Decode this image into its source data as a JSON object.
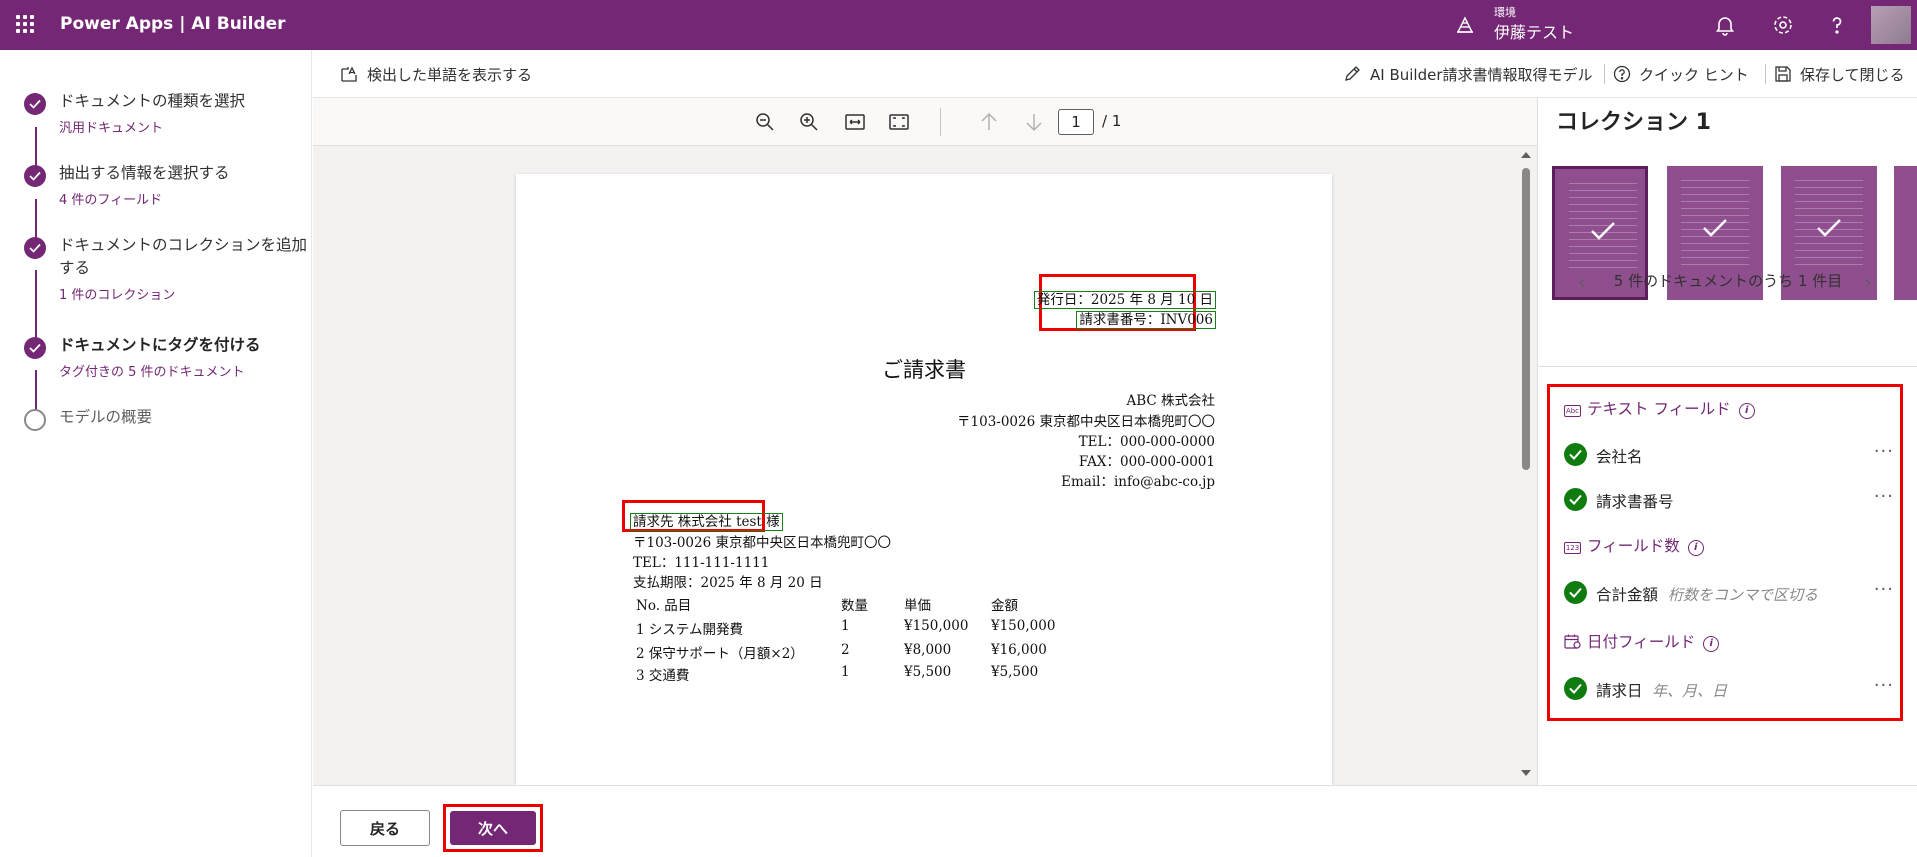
{
  "topbar": {
    "brand": "Power Apps  |  AI Builder",
    "env_label": "環境",
    "env_name": "伊藤テスト"
  },
  "steps": [
    {
      "title": "ドキュメントの種類を選択",
      "sub": "汎用ドキュメント",
      "state": "done"
    },
    {
      "title": "抽出する情報を選択する",
      "sub": "4 件のフィールド",
      "state": "done"
    },
    {
      "title": "ドキュメントのコレクションを追加する",
      "sub": "1 件のコレクション",
      "state": "done"
    },
    {
      "title": "ドキュメントにタグを付ける",
      "sub": "タグ付きの 5 件のドキュメント",
      "state": "current"
    },
    {
      "title": "モデルの概要",
      "sub": "",
      "state": "pending"
    }
  ],
  "toolbar": {
    "show_words": "検出した単語を表示する",
    "model_name": "AI Builder請求書情報取得モデル",
    "quick_hint": "クイック ヒント",
    "save_close": "保存して閉じる"
  },
  "viewer": {
    "page_current": "1",
    "page_total": "/ 1"
  },
  "doc": {
    "issue_date": "発行日：2025 年 8 月 10 日",
    "invoice_no": "請求書番号：INV006",
    "title": "ご請求書",
    "company": "ABC 株式会社",
    "address": "〒103-0026  東京都中央区日本橋兜町〇〇",
    "tel": "TEL：000-000-0000",
    "fax": "FAX：000-000-0001",
    "email": "Email：info@abc-co.jp",
    "bill_to": "請求先  株式会社 test  様",
    "client_address": "〒103-0026  東京都中央区日本橋兜町〇〇",
    "client_tel": "TEL：111-111-1111",
    "due_date": "支払期限：2025 年 8 月 20 日",
    "table": {
      "headers": [
        "No. 品目",
        "数量",
        "単価",
        "金額"
      ],
      "rows": [
        [
          "1     システム開発費",
          "1",
          "¥150,000",
          "¥150,000"
        ],
        [
          "2     保守サポート（月額×2）",
          "2",
          "¥8,000",
          "¥16,000"
        ],
        [
          "3     交通費",
          "1",
          "¥5,500",
          "¥5,500"
        ]
      ]
    }
  },
  "collection": {
    "title": "コレクション 1",
    "pager": "5 件のドキュメントのうち 1 件目"
  },
  "fields": {
    "text_header": "テキスト フィールド",
    "number_header": "フィールド数",
    "date_header": "日付フィールド",
    "text_badge": "Abc",
    "number_badge": "123",
    "items": {
      "company": {
        "name": "会社名",
        "hint": ""
      },
      "invoice": {
        "name": "請求書番号",
        "hint": ""
      },
      "total": {
        "name": "合計金額",
        "hint": "桁数をコンマで区切る"
      },
      "date": {
        "name": "請求日",
        "hint": "年、月、日"
      }
    }
  },
  "footer": {
    "back": "戻る",
    "next": "次へ"
  },
  "colors": {
    "brand": "#742774",
    "success": "#107c10",
    "highlight": "#e00000"
  }
}
